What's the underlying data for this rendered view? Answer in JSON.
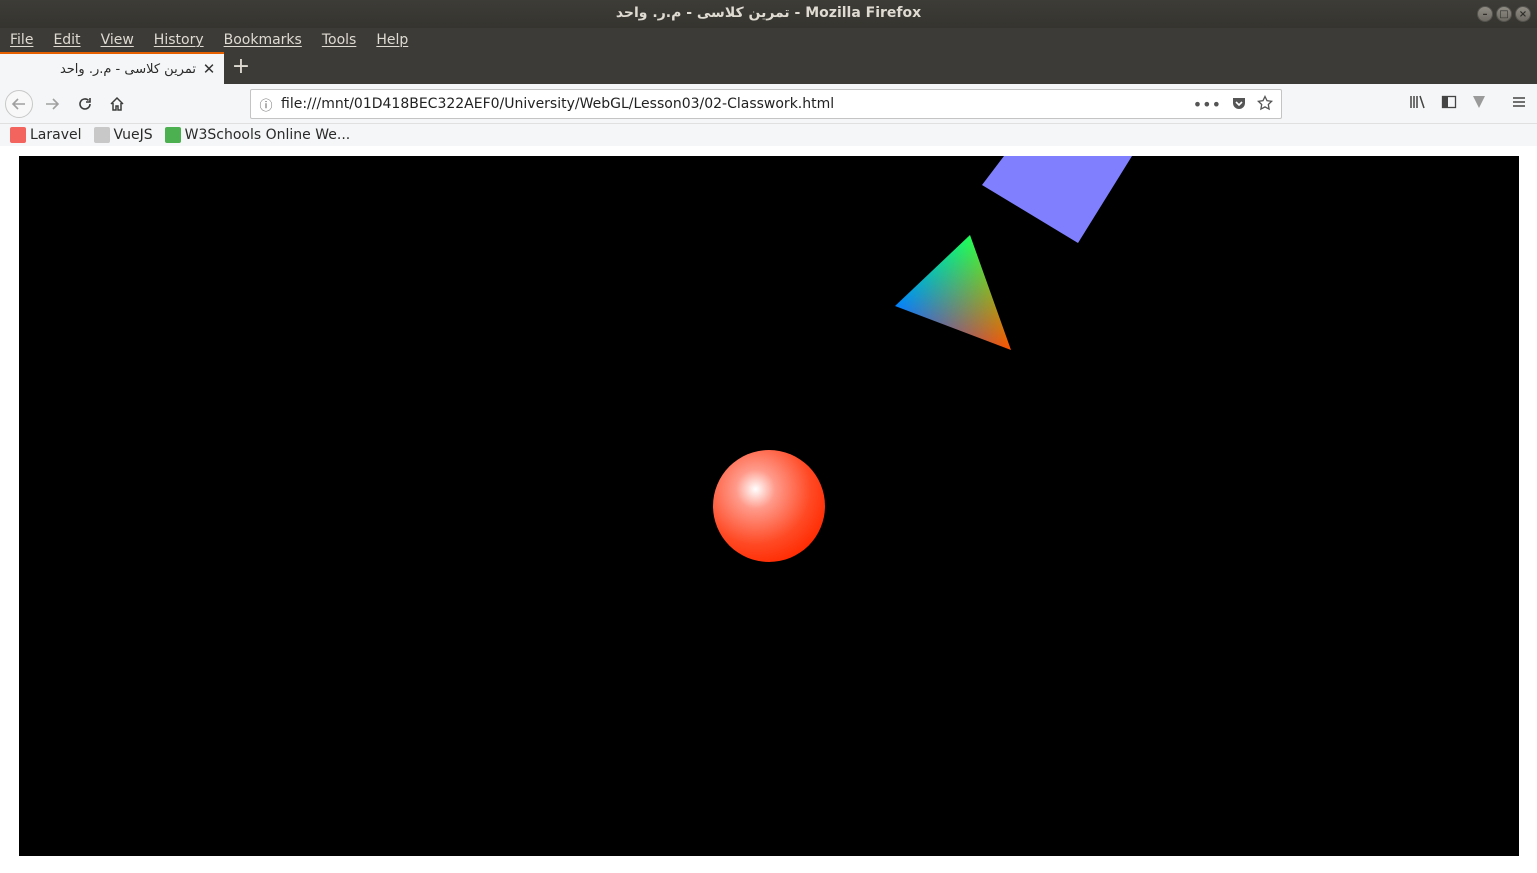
{
  "window": {
    "title": "تمرین کلاسی - م.ر. واحد - Mozilla Firefox",
    "controls": {
      "minimize": "–",
      "maximize": "□",
      "close": "×"
    }
  },
  "menu": {
    "items": [
      "File",
      "Edit",
      "View",
      "History",
      "Bookmarks",
      "Tools",
      "Help"
    ]
  },
  "tab": {
    "title": "تمرین کلاسی - م.ر. واحد",
    "close_glyph": "✕",
    "new_tab_glyph": "+"
  },
  "nav": {
    "url": "file:///mnt/01D418BEC322AEF0/University/WebGL/Lesson03/02-Classwork.html"
  },
  "bookmarks": [
    {
      "label": "Laravel",
      "color": "#f4645f"
    },
    {
      "label": "VueJS",
      "color": "#b9b9b9"
    },
    {
      "label": "W3Schools Online We...",
      "color": "#4caf50"
    }
  ],
  "scene": {
    "background": "#000000",
    "square_color": "#8080ff",
    "sphere_color": "#ff3b1a",
    "triangle_colors": [
      "#00ff00",
      "#0000ff",
      "#ff0000"
    ]
  }
}
